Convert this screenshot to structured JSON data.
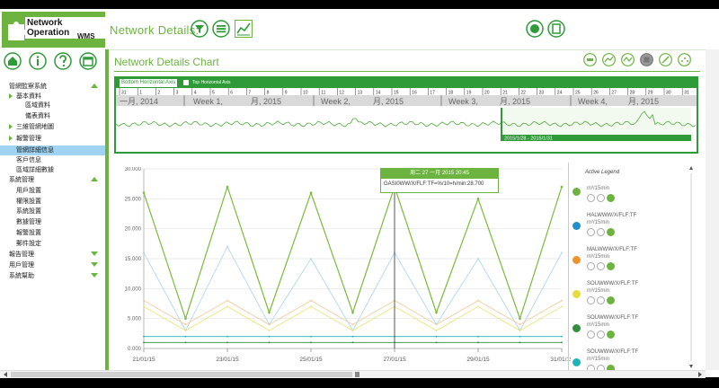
{
  "app": {
    "logo_line1": "Network Operation",
    "logo_line2": "WMS",
    "title": "Network Details:",
    "colors": {
      "brand_green": "#6cb43f",
      "dark_green": "#2e9b38",
      "highlight_blue": "#9fd3f1"
    }
  },
  "toolbar_icons": [
    "filter-icon",
    "list-icon",
    "line-chart-icon"
  ],
  "top_right_icons": [
    "globe-icon",
    "window-icon"
  ],
  "sidebar": {
    "icons": [
      "home-icon",
      "info-icon",
      "help-icon",
      "calendar-icon"
    ],
    "items": [
      {
        "label": "管網監察系統",
        "indent": 10,
        "arrow": "up"
      },
      {
        "label": "基本資料",
        "indent": 18,
        "arrow": "left-open"
      },
      {
        "label": "區域資料",
        "indent": 28,
        "arrow": ""
      },
      {
        "label": "儀表資料",
        "indent": 28,
        "arrow": ""
      },
      {
        "label": "三維管網地圖",
        "indent": 18,
        "arrow": "right"
      },
      {
        "label": "報警管理",
        "indent": 18,
        "arrow": "right"
      },
      {
        "label": "管網詳細信息",
        "indent": 18,
        "arrow": "",
        "selected": true
      },
      {
        "label": "客戶信息",
        "indent": 18,
        "arrow": ""
      },
      {
        "label": "區域詳細數據",
        "indent": 18,
        "arrow": ""
      },
      {
        "label": "系統管理",
        "indent": 10,
        "arrow": "up"
      },
      {
        "label": "用戶設置",
        "indent": 18,
        "arrow": ""
      },
      {
        "label": "權限設置",
        "indent": 18,
        "arrow": ""
      },
      {
        "label": "系統設置",
        "indent": 18,
        "arrow": ""
      },
      {
        "label": "數據管理",
        "indent": 18,
        "arrow": ""
      },
      {
        "label": "報警設置",
        "indent": 18,
        "arrow": ""
      },
      {
        "label": "郵件設定",
        "indent": 18,
        "arrow": ""
      },
      {
        "label": "報告管理",
        "indent": 10,
        "arrow": "down"
      },
      {
        "label": "用戶管理",
        "indent": 10,
        "arrow": "down"
      },
      {
        "label": "系統幫助",
        "indent": 10,
        "arrow": "down"
      }
    ]
  },
  "chart_panel": {
    "title": "Network Details Chart",
    "tool_icons": [
      "zoom-icon",
      "trend-icon",
      "compare-icon",
      "stop-icon",
      "pencil-icon",
      "scatter-icon"
    ],
    "nav_tabs": [
      "Bottom Horizontal Axis",
      "Top Horizontal Axis"
    ],
    "nav_ticks": [
      "31",
      "1",
      "2",
      "3",
      "4",
      "5",
      "6",
      "7",
      "8",
      "9",
      "10",
      "11",
      "12",
      "13",
      "14",
      "15",
      "16",
      "17",
      "18",
      "19",
      "20",
      "21",
      "22",
      "23",
      "24",
      "25",
      "26",
      "27",
      "28",
      "29",
      "30",
      "31"
    ],
    "nav_weeks": [
      "一月, 2014",
      "Week 1,",
      "月, 2015",
      "Week 2,",
      "月, 2015",
      "Week 3,",
      "月, 2015",
      "Week 4,",
      "月, 2015"
    ],
    "nav_range": "2015/1/28 - 2015/1/31"
  },
  "tooltip": {
    "header": "周二 27 一月 2015 20:45",
    "value": "GASI0WW/X/FLF:TF=%/10=h/min:28.700"
  },
  "legend": {
    "title": "Active Legend",
    "items": [
      {
        "name": "",
        "unit": "m³/15min",
        "color": "#6cb43f"
      },
      {
        "name": "HALWWW/X/FLF:TF",
        "unit": "m³/15min",
        "color": "#1f8fd0"
      },
      {
        "name": "MALWWW/X/FLF:TF",
        "unit": "m³/15min",
        "color": "#f0922b"
      },
      {
        "name": "SOUWWW/X/FLF:TF",
        "unit": "m³/15min",
        "color": "#e6dd3a"
      },
      {
        "name": "SOUWWW/X/FLF:TF",
        "unit": "m³/15min",
        "color": "#2f8f3a"
      },
      {
        "name": "SOUWWW/X/FLF:TF",
        "unit": "m³/15min",
        "color": "#1fb5b8"
      }
    ]
  },
  "chart_data": {
    "type": "line",
    "x": [
      "21/01/15",
      "22/01/15",
      "23/01/15",
      "24/01/15",
      "25/01/15",
      "26/01/15",
      "27/01/15",
      "28/01/15",
      "29/01/15",
      "30/01/15",
      "31/01/15"
    ],
    "x_ticks": [
      "21/01/15",
      "23/01/15",
      "25/01/15",
      "27/01/15",
      "29/01/15",
      "31/01/15"
    ],
    "y_ticks": [
      "0.000",
      "5.000",
      "10.000",
      "15.000",
      "20.000",
      "25.000",
      "30.000"
    ],
    "ylim": [
      0,
      30
    ],
    "grid": true,
    "series": [
      {
        "color": "#7bbb3a",
        "values": [
          26,
          5,
          27,
          6,
          26,
          6,
          27,
          6,
          25,
          5,
          27
        ]
      },
      {
        "color": "#a6d4ee",
        "values": [
          16,
          3,
          17,
          4,
          15,
          3,
          16,
          4,
          15,
          3,
          16
        ]
      },
      {
        "color": "#f3c48f",
        "values": [
          8,
          4,
          8,
          4,
          8,
          4,
          8,
          4,
          8,
          4,
          8
        ]
      },
      {
        "color": "#e8e46a",
        "values": [
          7,
          3,
          7,
          3,
          7,
          3,
          7,
          3,
          7,
          3,
          7
        ]
      },
      {
        "color": "#2f8f3a",
        "values": [
          1,
          1,
          1,
          1,
          1,
          1,
          1,
          1,
          1,
          1,
          1
        ]
      },
      {
        "color": "#1fb5b8",
        "values": [
          2,
          2,
          2,
          2,
          2,
          2,
          2,
          2,
          2,
          2,
          2
        ]
      }
    ],
    "cursor_x": "27/01/15"
  }
}
